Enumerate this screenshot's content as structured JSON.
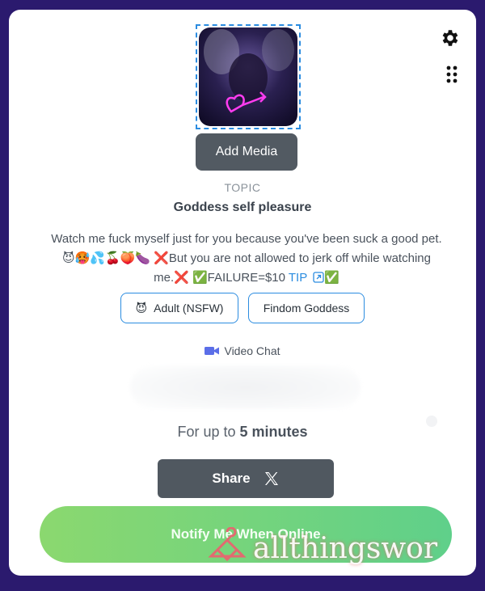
{
  "media": {
    "add_label": "Add Media"
  },
  "topic": {
    "label": "TOPIC",
    "title": "Goddess self pleasure"
  },
  "description": {
    "line1": "Watch me fuck myself just for you because you've been suck a good pet.",
    "line2": "😈🥵💦🍒🍑🍆 ❌But you are not allowed to jerk off while watching",
    "line3_prefix": "me.❌ ✅FAILURE=$10 ",
    "tip_label": "TIP",
    "line3_suffix": "✅"
  },
  "tags": [
    {
      "emoji": "😈",
      "label": "Adult (NSFW)"
    },
    {
      "label": "Findom Goddess"
    }
  ],
  "video_chat": {
    "label": "Video Chat"
  },
  "duration": {
    "prefix": "For up to ",
    "value": "5 minutes"
  },
  "share": {
    "label": "Share",
    "platform": "X"
  },
  "notify": {
    "label": "Notify Me When Online"
  },
  "watermark": {
    "text": "allthingswor"
  },
  "colors": {
    "accent": "#2b8ce0",
    "dark_button": "#525a62",
    "notify_start": "#8bd86f",
    "notify_end": "#5fd08a",
    "background": "#2b1a6e"
  },
  "icons": {
    "settings": "gear-icon",
    "more": "dots-grid-icon",
    "video": "video-camera-icon",
    "share": "x-logo-icon",
    "external": "external-link-icon"
  }
}
